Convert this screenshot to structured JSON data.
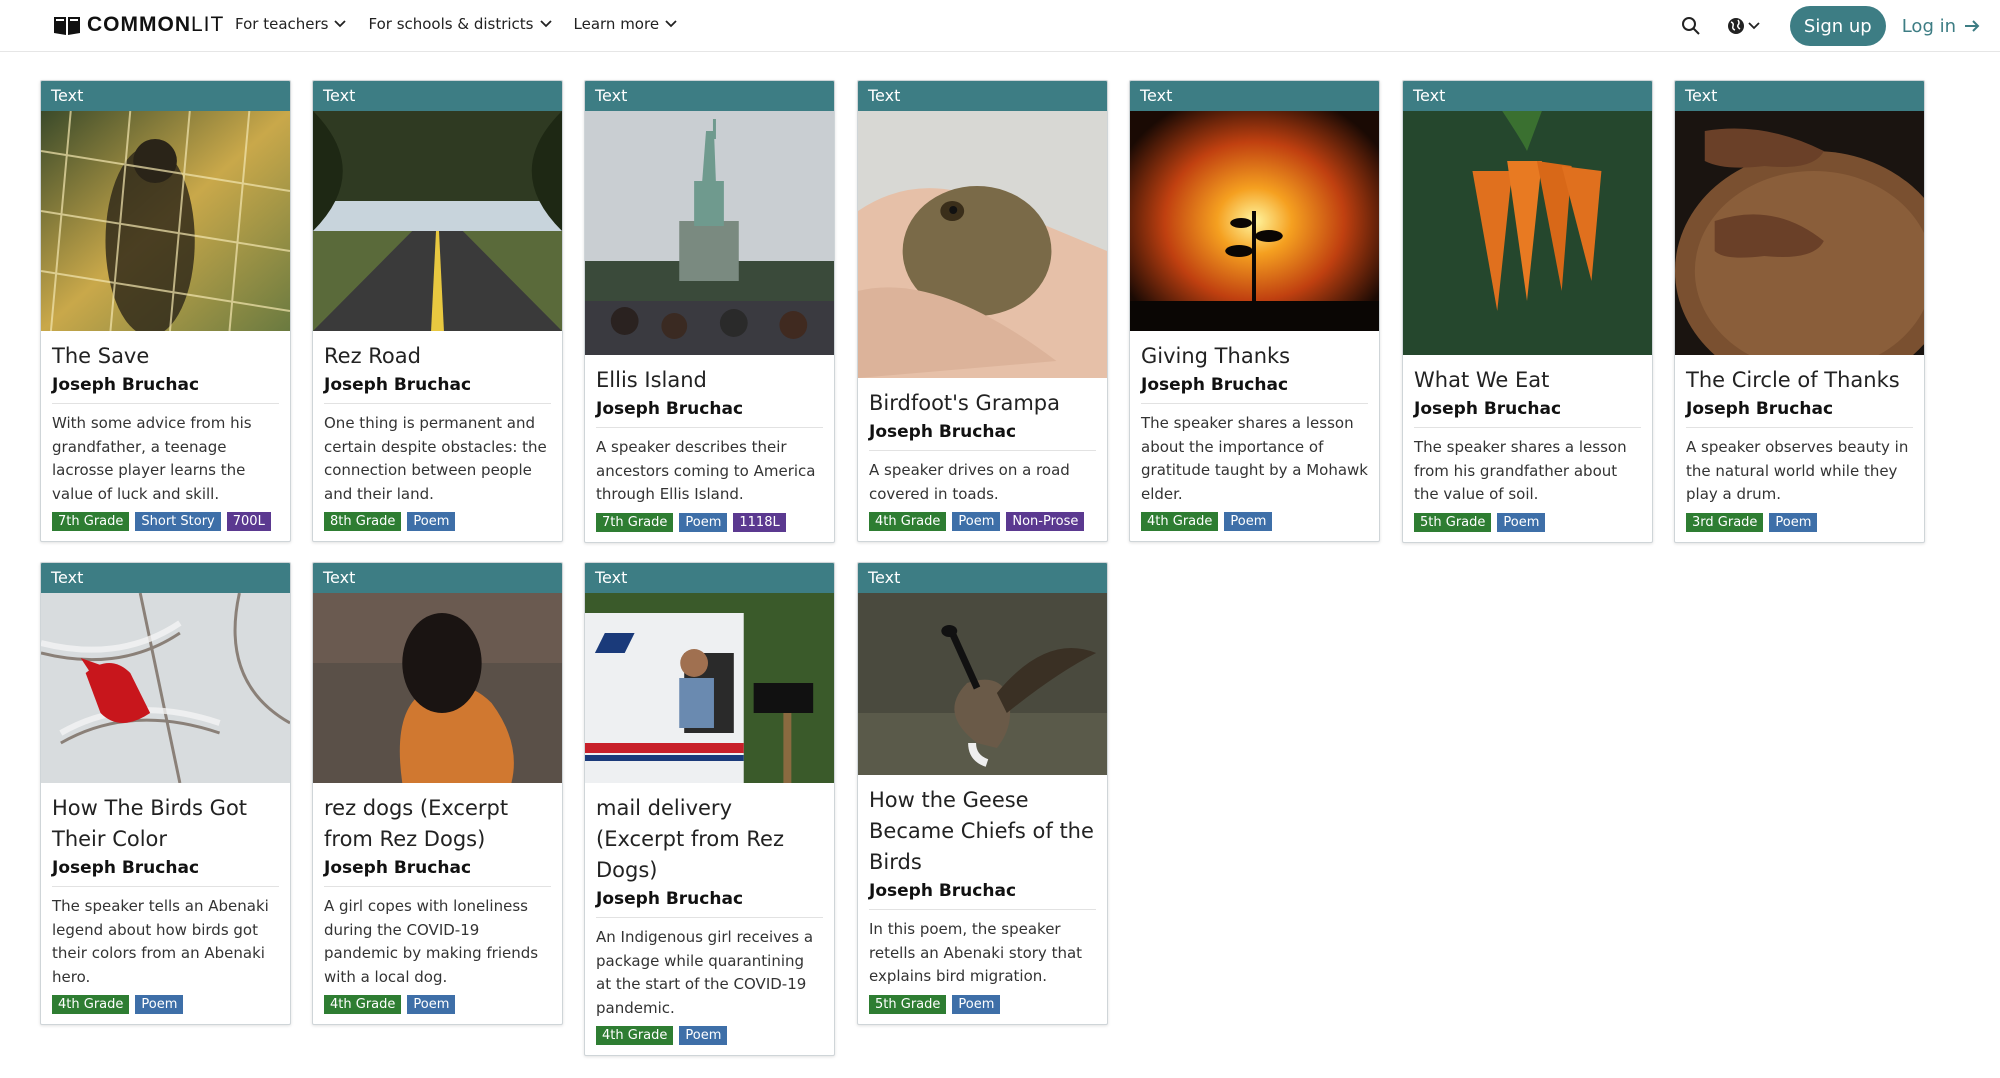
{
  "header": {
    "logo_text_bold": "COMMON",
    "logo_text_regular": "LIT",
    "nav": [
      "For teachers",
      "For schools & districts",
      "Learn more"
    ],
    "signup": "Sign up",
    "login": "Log in"
  },
  "colors": {
    "teal": "#3d7d84",
    "grade": "#2e7d32",
    "genre": "#3e6fa8",
    "lexile": "#5b3990"
  },
  "cards": [
    {
      "band": "Text",
      "title": "The Save",
      "author": "Joseph Bruchac",
      "desc": "With some advice from his grandfather, a teenage lacrosse player learns the value of luck and skill.",
      "tags": [
        "7th Grade",
        "Short Story",
        "700L"
      ],
      "image": "lacrosse-net-photo"
    },
    {
      "band": "Text",
      "title": "Rez Road",
      "author": "Joseph Bruchac",
      "desc": "One thing is permanent and certain despite obstacles: the connection between people and their land.",
      "tags": [
        "8th Grade",
        "Poem"
      ],
      "image": "tree-lined-road-photo"
    },
    {
      "band": "Text",
      "title": "Ellis Island",
      "author": "Joseph Bruchac",
      "desc": "A speaker describes their ancestors coming to America through Ellis Island.",
      "tags": [
        "7th Grade",
        "Poem",
        "1118L"
      ],
      "image": "statue-of-liberty-photo"
    },
    {
      "band": "Text",
      "title": "Birdfoot's Grampa",
      "author": "Joseph Bruchac",
      "desc": "A speaker drives on a road covered in toads.",
      "tags": [
        "4th Grade",
        "Poem",
        "Non-Prose"
      ],
      "image": "toad-in-hand-photo"
    },
    {
      "band": "Text",
      "title": "Giving Thanks",
      "author": "Joseph Bruchac",
      "desc": "The speaker shares a lesson about the importance of gratitude taught by a Mohawk elder.",
      "tags": [
        "4th Grade",
        "Poem"
      ],
      "image": "sunset-sprout-photo"
    },
    {
      "band": "Text",
      "title": "What We Eat",
      "author": "Joseph Bruchac",
      "desc": "The speaker shares a lesson from his grandfather about the value of soil.",
      "tags": [
        "5th Grade",
        "Poem"
      ],
      "image": "carrots-photo"
    },
    {
      "band": "Text",
      "title": "The Circle of Thanks",
      "author": "Joseph Bruchac",
      "desc": "A speaker observes beauty in the natural world while they play a drum.",
      "tags": [
        "3rd Grade",
        "Poem"
      ],
      "image": "hands-on-drum-photo"
    },
    {
      "band": "Text",
      "title": "How The Birds Got Their Color",
      "author": "Joseph Bruchac",
      "desc": "The speaker tells an Abenaki legend about how birds got their colors from an Abenaki hero.",
      "tags": [
        "4th Grade",
        "Poem"
      ],
      "image": "cardinal-in-snow-photo"
    },
    {
      "band": "Text",
      "title": "rez dogs (Excerpt from Rez Dogs)",
      "author": "Joseph Bruchac",
      "desc": "A girl copes with loneliness during the COVID-19 pandemic by making friends with a local dog.",
      "tags": [
        "4th Grade",
        "Poem"
      ],
      "image": "girl-by-lake-photo"
    },
    {
      "band": "Text",
      "title": "mail delivery (Excerpt from Rez Dogs)",
      "author": "Joseph Bruchac",
      "desc": "An Indigenous girl receives a package while quarantining at the start of the COVID-19 pandemic.",
      "tags": [
        "4th Grade",
        "Poem"
      ],
      "image": "mail-truck-photo"
    },
    {
      "band": "Text",
      "title": "How the Geese Became Chiefs of the Birds",
      "author": "Joseph Bruchac",
      "desc": "In this poem, the speaker retells an Abenaki story that explains bird migration.",
      "tags": [
        "5th Grade",
        "Poem"
      ],
      "image": "goose-photo"
    }
  ]
}
